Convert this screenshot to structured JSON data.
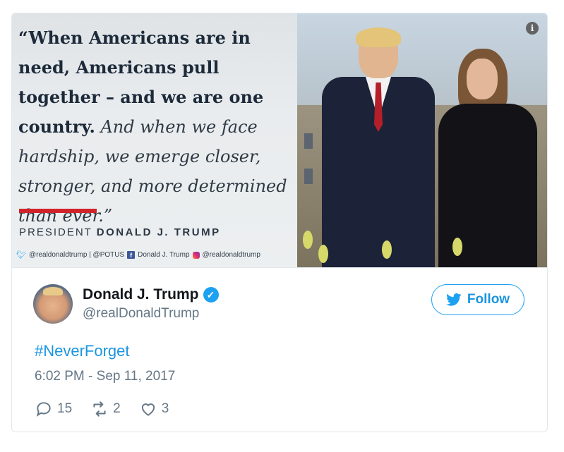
{
  "media": {
    "quote_bold": "“When Americans are in need, Americans pull together – and we are one country.",
    "quote_plain": "And when we face hardship, we emerge closer, stronger, and more determined than ever.”",
    "byline_prefix": "PRESIDENT",
    "byline_name": "DONALD J. TRUMP",
    "social_twitter": "@realdonaldtrump | @POTUS",
    "social_facebook": "Donald J. Trump",
    "social_instagram": "@realdonaldtrump",
    "info_icon_glyph": "i"
  },
  "author": {
    "display_name": "Donald J. Trump",
    "handle": "@realDonaldTrump",
    "verified_glyph": "✓"
  },
  "follow_button": {
    "label": "Follow"
  },
  "tweet": {
    "hashtag": "#NeverForget",
    "timestamp": "6:02 PM - Sep 11, 2017"
  },
  "actions": {
    "replies": "15",
    "retweets": "2",
    "likes": "3"
  },
  "colors": {
    "accent": "#1da1f2",
    "link": "#1b95e0",
    "muted": "#657786",
    "red_bar": "#d2232a"
  }
}
